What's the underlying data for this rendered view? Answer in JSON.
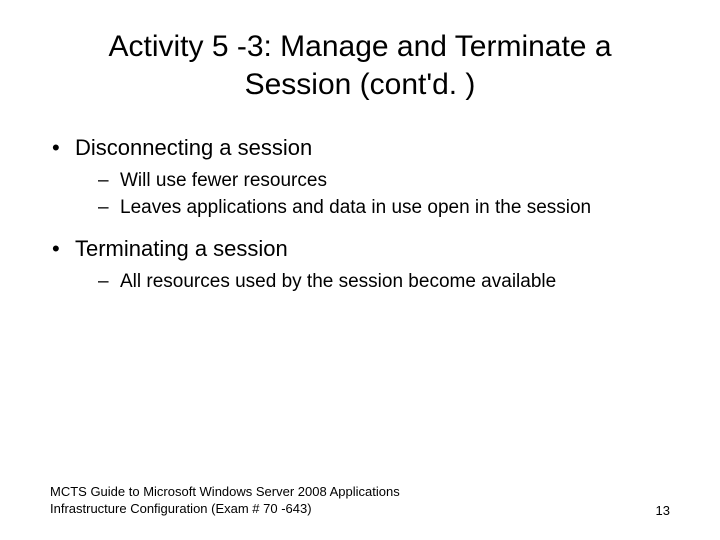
{
  "title": "Activity 5 -3: Manage and Terminate a Session (cont'd. )",
  "bullets": [
    {
      "text": "Disconnecting a session",
      "sub": [
        "Will use fewer resources",
        "Leaves applications and data in use open in the session"
      ]
    },
    {
      "text": "Terminating a session",
      "sub": [
        "All resources used by the session become available"
      ]
    }
  ],
  "footer_left": "MCTS Guide to Microsoft Windows Server 2008 Applications Infrastructure Configuration (Exam # 70 -643)",
  "footer_right": "13"
}
